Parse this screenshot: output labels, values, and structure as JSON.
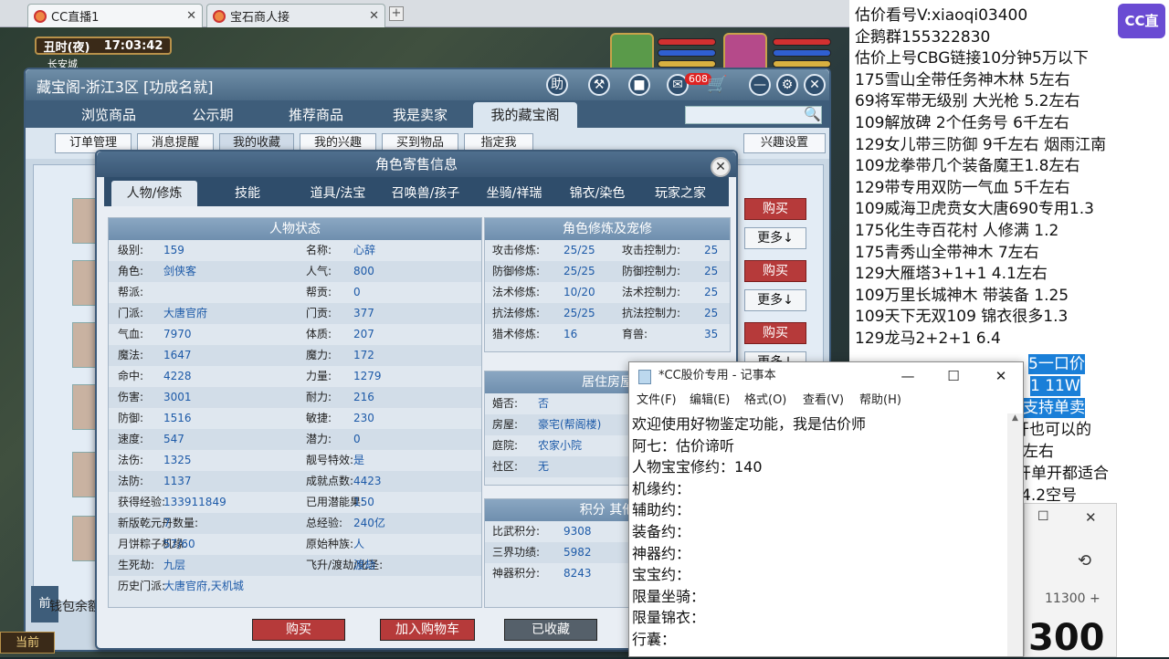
{
  "browser_tabs": [
    {
      "label": "CC直播1"
    },
    {
      "label": "宝石商人接"
    }
  ],
  "game": {
    "time_label": "丑时(夜)",
    "clock": "17:03:42",
    "location": "长安城"
  },
  "cbg": {
    "title": "藏宝阁-浙江3区 [功成名就]",
    "help_label": "助",
    "cart_count": "608",
    "nav": [
      "浏览商品",
      "公示期",
      "推荐商品",
      "我是卖家",
      "我的藏宝阁"
    ],
    "subnav": [
      "订单管理",
      "消息提醒",
      "我的收藏",
      "我的兴趣",
      "买到物品",
      "指定我"
    ],
    "interest_settings": "兴趣设置",
    "buy_label": "购买",
    "more_label": "更多↓",
    "wallet_label": "钱包余额",
    "current_label": "当前"
  },
  "role_dialog": {
    "title": "角色寄售信息",
    "tabs": [
      "人物/修炼",
      "技能",
      "道具/法宝",
      "召唤兽/孩子",
      "坐骑/祥瑞",
      "锦衣/染色",
      "玩家之家"
    ],
    "status_title": "人物状态",
    "status_rows": [
      {
        "l1": "级别:",
        "v1": "159",
        "l2": "名称:",
        "v2": "心辞"
      },
      {
        "l1": "角色:",
        "v1": "剑侠客",
        "l2": "人气:",
        "v2": "800"
      },
      {
        "l1": "帮派:",
        "v1": "",
        "l2": "帮贡:",
        "v2": "0"
      },
      {
        "l1": "门派:",
        "v1": "大唐官府",
        "l2": "门贡:",
        "v2": "377"
      },
      {
        "l1": "气血:",
        "v1": "7970",
        "l2": "体质:",
        "v2": "207"
      },
      {
        "l1": "魔法:",
        "v1": "1647",
        "l2": "魔力:",
        "v2": "172"
      },
      {
        "l1": "命中:",
        "v1": "4228",
        "l2": "力量:",
        "v2": "1279"
      },
      {
        "l1": "伤害:",
        "v1": "3001",
        "l2": "耐力:",
        "v2": "216"
      },
      {
        "l1": "防御:",
        "v1": "1516",
        "l2": "敏捷:",
        "v2": "230"
      },
      {
        "l1": "速度:",
        "v1": "547",
        "l2": "潜力:",
        "v2": "0"
      },
      {
        "l1": "法伤:",
        "v1": "1325",
        "l2": "靓号特效:",
        "v2": "是"
      },
      {
        "l1": "法防:",
        "v1": "1137",
        "l2": "成就点数:",
        "v2": "4423"
      },
      {
        "l1": "获得经验:",
        "v1": "133911849",
        "l2": "已用潜能果:",
        "v2": "150"
      },
      {
        "l1": "新版乾元丹数量:",
        "v1": "7",
        "l2": "总经验:",
        "v2": "240亿"
      },
      {
        "l1": "月饼粽子机缘:",
        "v1": "57/60",
        "l2": "原始种族:",
        "v2": "人"
      },
      {
        "l1": "生死劫:",
        "v1": "九层",
        "l2": "飞升/渡劫/化圣:",
        "v2": "渡劫"
      },
      {
        "l1": "历史门派:",
        "v1": "大唐官府,天机城",
        "l2": "",
        "v2": ""
      }
    ],
    "cultivation_title": "角色修炼及宠修",
    "cultivation_rows": [
      {
        "l1": "攻击修炼:",
        "v1": "25/25",
        "l2": "攻击控制力:",
        "v2": "25"
      },
      {
        "l1": "防御修炼:",
        "v1": "25/25",
        "l2": "防御控制力:",
        "v2": "25"
      },
      {
        "l1": "法术修炼:",
        "v1": "10/20",
        "l2": "法术控制力:",
        "v2": "25"
      },
      {
        "l1": "抗法修炼:",
        "v1": "25/25",
        "l2": "抗法控制力:",
        "v2": "25"
      },
      {
        "l1": "猎术修炼:",
        "v1": "16",
        "l2": "育兽:",
        "v2": "35"
      }
    ],
    "residence_title": "居住房屋",
    "residence_rows": [
      {
        "l": "婚否:",
        "v": "否"
      },
      {
        "l": "房屋:",
        "v": "豪宅(帮阁楼)"
      },
      {
        "l": "庭院:",
        "v": "农家小院"
      },
      {
        "l": "社区:",
        "v": "无"
      }
    ],
    "score_title": "积分 其他",
    "score_rows": [
      {
        "l": "比武积分:",
        "v": "9308"
      },
      {
        "l": "三界功绩:",
        "v": "5982"
      },
      {
        "l": "神器积分:",
        "v": "8243"
      }
    ],
    "buttons": {
      "buy": "购买",
      "add_cart": "加入购物车",
      "favorited": "已收藏"
    }
  },
  "side": {
    "lines": [
      "估价看号V:xiaoqi03400",
      "企鹅群155322830",
      "估价上号CBG链接10分钟5万以下",
      "175雪山全带任务神木林 5左右",
      "69将军带无级别 大光枪 5.2左右",
      "109解放碑 2个任务号 6千左右",
      "129女儿带三防御 9千左右 烟雨江南",
      "109龙拳带几个装备魔王1.8左右",
      "129带专用双防一气血 5千左右",
      "109威海卫虎贲女大唐690专用1.3",
      "175化生寺百花村 人修满 1.2",
      "175青秀山全带神木 7左右",
      "129大雁塔3+1+1  4.1左右",
      "109万里长城神木 带装备  1.25",
      "109天下无双109  锦衣很多1.3",
      "129龙马2+2+1  6.4"
    ],
    "partial_lines": [
      "5一口价",
      "1 11W",
      "支持单卖",
      "开也可以的",
      "左右",
      "开单开都适合",
      "4.2空号"
    ],
    "logo": "CC直播"
  },
  "notepad": {
    "title": "*CC股价专用 - 记事本",
    "menu": [
      "文件(F)",
      "编辑(E)",
      "格式(O)",
      "查看(V)",
      "帮助(H)"
    ],
    "lines": [
      "欢迎使用好物鉴定功能，我是估价师",
      "阿七：估价谛听",
      "人物宝宝修约：140",
      "机缘约：",
      "辅助约：",
      "装备约：",
      "神器约：",
      "宝宝约：",
      "限量坐骑：",
      "限量锦衣：",
      "行囊："
    ]
  },
  "calculator": {
    "expression": "11300 +",
    "display": "300"
  }
}
